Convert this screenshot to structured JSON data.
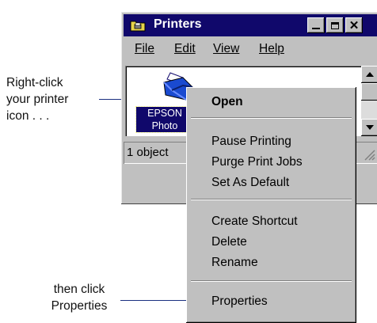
{
  "callouts": {
    "first": [
      "Right-click",
      "your printer",
      "icon . . ."
    ],
    "second": [
      "then click",
      "Properties"
    ]
  },
  "window": {
    "title": "Printers",
    "menu": {
      "file": "File",
      "edit": "Edit",
      "view": "View",
      "help": "Help"
    },
    "printer": {
      "label_line1": "EPSON",
      "label_line2": "Photo"
    },
    "status": "1 object"
  },
  "context_menu": {
    "open": "Open",
    "pause": "Pause Printing",
    "purge": "Purge Print Jobs",
    "default": "Set As Default",
    "shortcut": "Create Shortcut",
    "delete": "Delete",
    "rename": "Rename",
    "properties": "Properties"
  },
  "colors": {
    "titlebar": "#10086b",
    "selection": "#10086b",
    "face": "#c0c0c0",
    "leader": "#1a2f80"
  }
}
